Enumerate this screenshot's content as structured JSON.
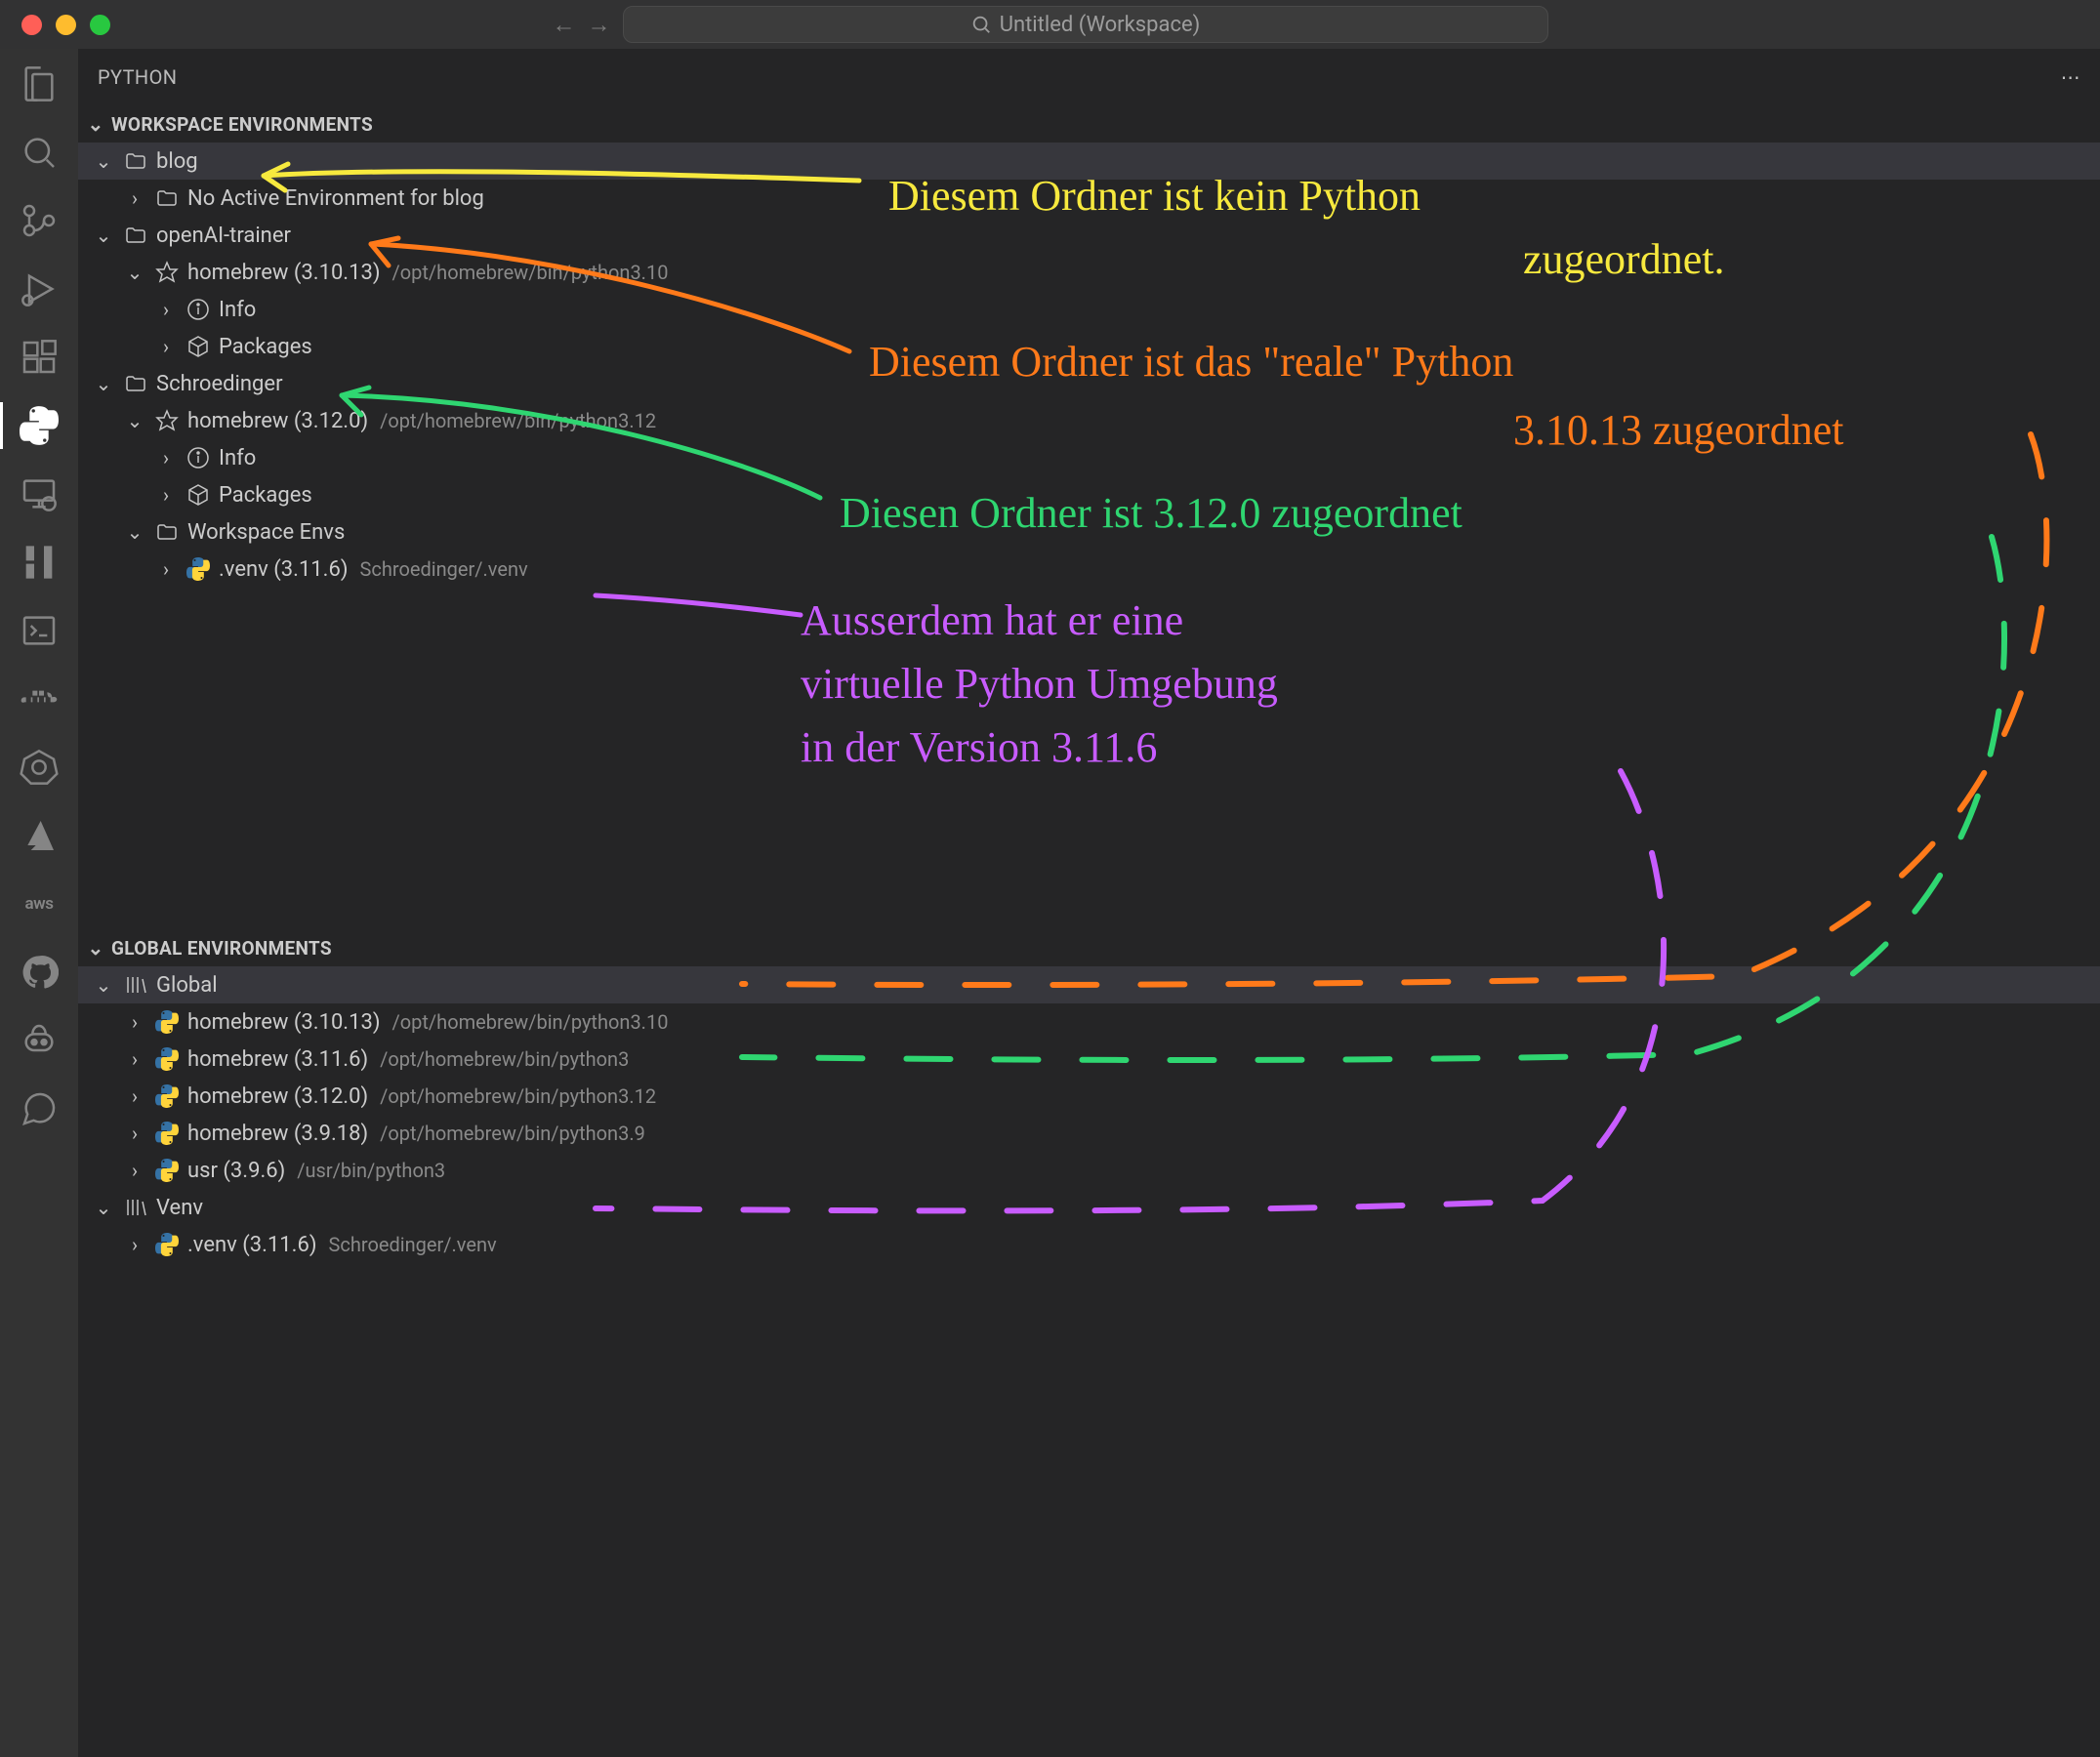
{
  "titlebar": {
    "search_placeholder": "Untitled (Workspace)"
  },
  "sidebar": {
    "title": "PYTHON",
    "sections": {
      "workspace": {
        "label": "WORKSPACE ENVIRONMENTS",
        "folders": [
          {
            "name": "blog",
            "no_env_label": "No Active Environment for blog"
          },
          {
            "name": "openAI-trainer",
            "env": {
              "label": "homebrew (3.10.13)",
              "path": "/opt/homebrew/bin/python3.10"
            },
            "info_label": "Info",
            "packages_label": "Packages"
          },
          {
            "name": "Schroedinger",
            "env": {
              "label": "homebrew (3.12.0)",
              "path": "/opt/homebrew/bin/python3.12"
            },
            "info_label": "Info",
            "packages_label": "Packages",
            "workspace_envs_label": "Workspace Envs",
            "venv": {
              "label": ".venv (3.11.6)",
              "path": "Schroedinger/.venv"
            }
          }
        ]
      },
      "global": {
        "label": "GLOBAL ENVIRONMENTS",
        "group_global_label": "Global",
        "items": [
          {
            "label": "homebrew (3.10.13)",
            "path": "/opt/homebrew/bin/python3.10"
          },
          {
            "label": "homebrew (3.11.6)",
            "path": "/opt/homebrew/bin/python3"
          },
          {
            "label": "homebrew (3.12.0)",
            "path": "/opt/homebrew/bin/python3.12"
          },
          {
            "label": "homebrew (3.9.18)",
            "path": "/opt/homebrew/bin/python3.9"
          },
          {
            "label": "usr (3.9.6)",
            "path": "/usr/bin/python3"
          }
        ],
        "group_venv_label": "Venv",
        "venv_items": [
          {
            "label": ".venv (3.11.6)",
            "path": "Schroedinger/.venv"
          }
        ]
      }
    }
  },
  "annotations": {
    "yellow_line1": "Diesem Ordner ist kein Python",
    "yellow_line2": "zugeordnet.",
    "orange_line1": "Diesem Ordner ist das \"reale\" Python",
    "orange_line2": "3.10.13 zugeordnet",
    "green_line1": "Diesen Ordner ist 3.12.0 zugeordnet",
    "purple_line1": "Ausserdem hat er eine",
    "purple_line2": "virtuelle Python Umgebung",
    "purple_line3": "in der Version 3.11.6"
  },
  "colors": {
    "yellow": "#f7e93e",
    "orange": "#ff7a1a",
    "green": "#2fd671",
    "purple": "#c85cff"
  }
}
